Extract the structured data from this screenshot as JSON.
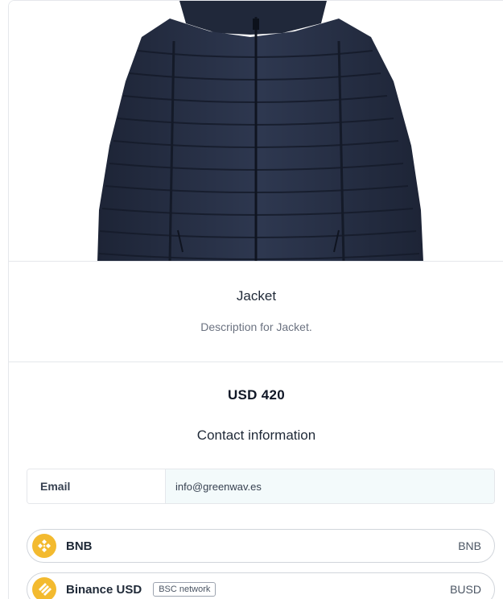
{
  "product": {
    "title": "Jacket",
    "description": "Description for Jacket."
  },
  "price": "USD 420",
  "contact": {
    "title": "Contact information",
    "email_label": "Email",
    "email_value": "info@greenwav.es"
  },
  "payment_options": [
    {
      "name": "BNB",
      "symbol": "BNB",
      "icon": "bnb-icon",
      "color": "#f3ba2f"
    },
    {
      "name": "Binance USD",
      "network": "BSC network",
      "symbol": "BUSD",
      "icon": "busd-icon",
      "color": "#f3ba2f"
    }
  ],
  "colors": {
    "border": "#e5e7eb",
    "input_bg": "#f3fafb",
    "jacket": "#2a3245",
    "coin": "#f3ba2f"
  }
}
